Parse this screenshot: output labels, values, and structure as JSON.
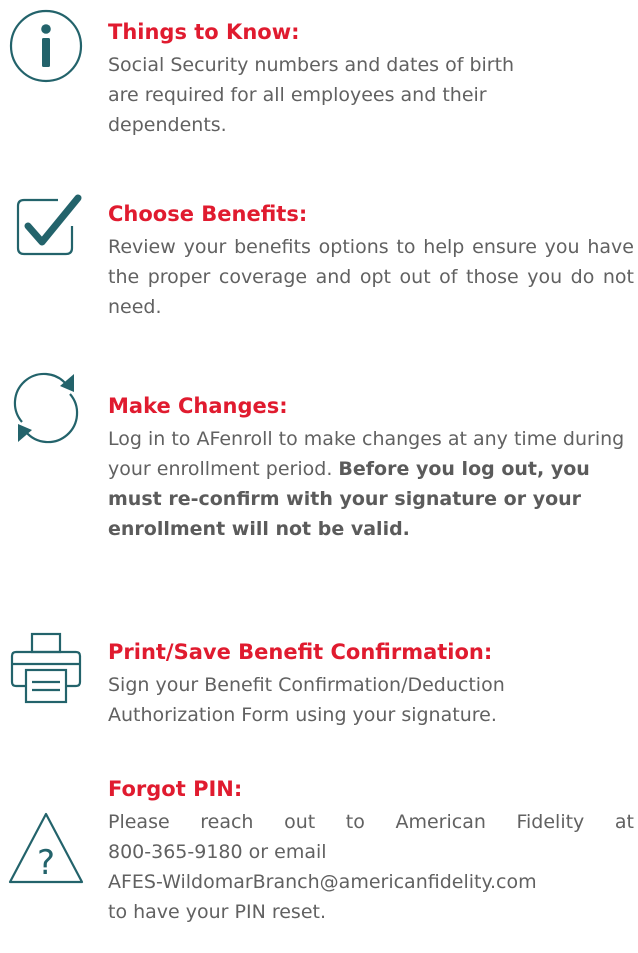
{
  "colors": {
    "heading": "#e01b2f",
    "icon": "#23636b",
    "body_text": "#616161"
  },
  "sections": [
    {
      "icon": "info-icon",
      "heading": "Things to Know:",
      "body": "Social Security numbers and dates of birth are required for all employees and  their dependents."
    },
    {
      "icon": "checkmark-icon",
      "heading": "Choose Benefits:",
      "body": "Review your benefits options to help ensure you have the proper coverage and opt out of those you do not need."
    },
    {
      "icon": "refresh-arrows-icon",
      "heading": "Make Changes:",
      "body": "Log in to AFenroll to make changes at any time during your enrollment period.",
      "body_bold": "Before you log out, you must re-confirm with your signature or your enrollment will not be valid."
    },
    {
      "icon": "printer-icon",
      "heading": "Print/Save Benefit Confirmation:",
      "body": "Sign your Benefit Confirmation/Deduction Authorization Form using your signature."
    },
    {
      "icon": "question-triangle-icon",
      "heading": "Forgot PIN:",
      "body_intro": "Please reach out to American Fidelity at",
      "phone": "800-365-9180",
      "email_prefix": "or email",
      "email": "AFES-WildomarBranch@americanfidelity.com",
      "body_end": "to have your PIN reset."
    }
  ]
}
